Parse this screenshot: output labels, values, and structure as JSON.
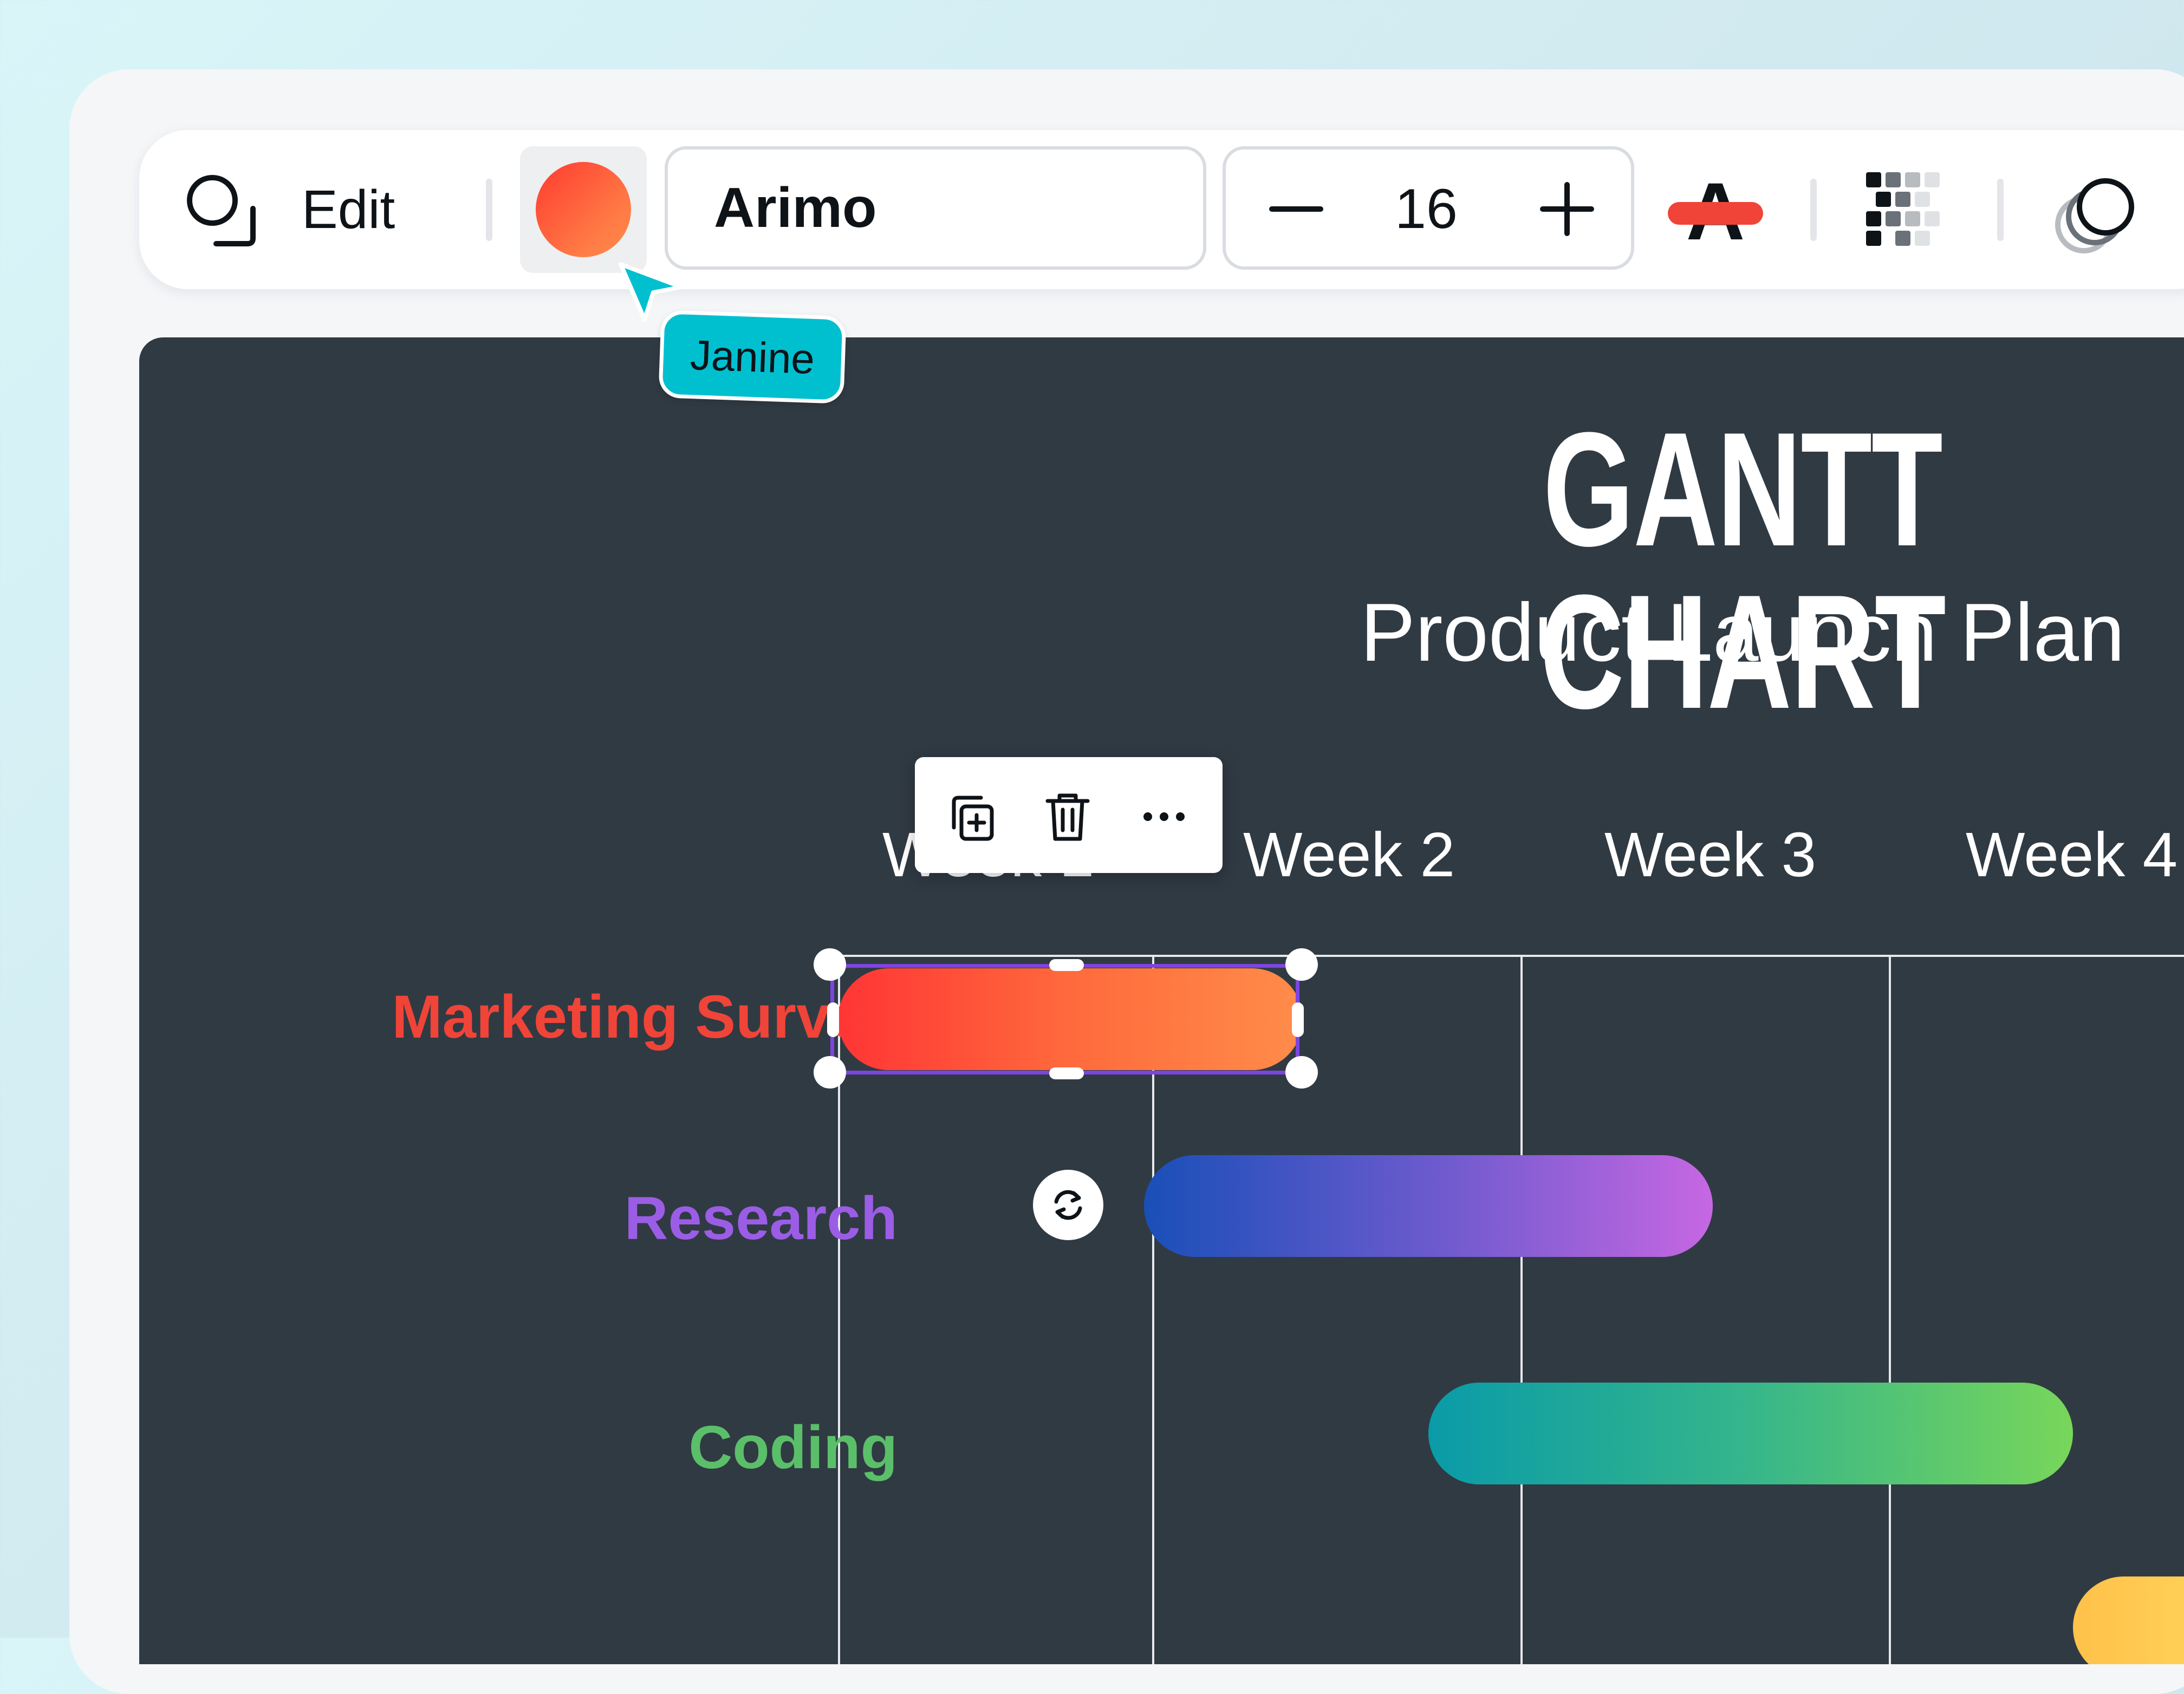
{
  "toolbar": {
    "edit_label": "Edit",
    "fill_color": "#ff5a3a",
    "font_name": "Arimo",
    "font_size": "16",
    "text_color_glyph": "A",
    "text_color": "#f04438"
  },
  "collaborator": {
    "name": "Janine",
    "color": "#00c0d0"
  },
  "canvas": {
    "title": "GANTT CHART",
    "subtitle": "Product Launch Plan",
    "background": "#303a43"
  },
  "chart_data": {
    "type": "bar",
    "title": "GANTT CHART",
    "subtitle": "Product Launch Plan",
    "categories": [
      "Week 1",
      "Week 2",
      "Week 3",
      "Week 4"
    ],
    "tasks": [
      {
        "name": "Marketing Survey",
        "start": 1.0,
        "end": 2.3,
        "color": "#ff4a36"
      },
      {
        "name": "Research",
        "start": 1.85,
        "end": 3.35,
        "color": "#7a58d0"
      },
      {
        "name": "Coding",
        "start": 2.6,
        "end": 4.3,
        "color": "#3cb47a"
      }
    ]
  },
  "context_menu": {
    "items": [
      "duplicate",
      "delete",
      "more"
    ]
  }
}
